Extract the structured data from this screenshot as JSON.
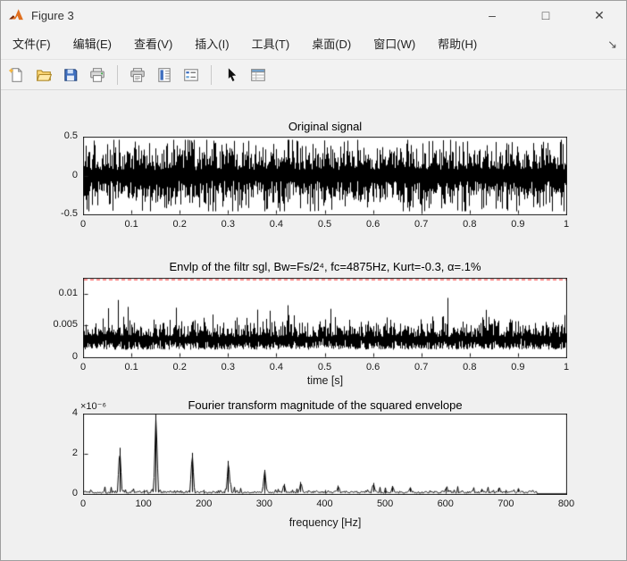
{
  "window": {
    "title": "Figure 3",
    "controls": {
      "minimize": "–",
      "maximize": "□",
      "close": "✕"
    }
  },
  "menu": {
    "items": [
      "文件(F)",
      "编辑(E)",
      "查看(V)",
      "插入(I)",
      "工具(T)",
      "桌面(D)",
      "窗口(W)",
      "帮助(H)"
    ],
    "dock_icon": "↘"
  },
  "toolbar": {
    "icons": [
      {
        "name": "new-figure"
      },
      {
        "name": "open-file"
      },
      {
        "name": "save-figure"
      },
      {
        "name": "print-figure"
      },
      {
        "name": "print-preview"
      },
      {
        "name": "insert-colorbar"
      },
      {
        "name": "insert-legend"
      },
      {
        "name": "edit-plot-pointer"
      },
      {
        "name": "property-inspector"
      }
    ]
  },
  "chart_data": [
    {
      "type": "line",
      "series_kind": "noise",
      "title": "Original signal",
      "xlabel": "",
      "xlim": [
        0,
        1
      ],
      "ylim": [
        -0.5,
        0.5
      ],
      "xticks": [
        {
          "v": 0,
          "label": "0"
        },
        {
          "v": 0.1,
          "label": "0.1"
        },
        {
          "v": 0.2,
          "label": "0.2"
        },
        {
          "v": 0.3,
          "label": "0.3"
        },
        {
          "v": 0.4,
          "label": "0.4"
        },
        {
          "v": 0.5,
          "label": "0.5"
        },
        {
          "v": 0.6,
          "label": "0.6"
        },
        {
          "v": 0.7,
          "label": "0.7"
        },
        {
          "v": 0.8,
          "label": "0.8"
        },
        {
          "v": 0.9,
          "label": "0.9"
        },
        {
          "v": 1,
          "label": "1"
        }
      ],
      "yticks": [
        {
          "v": -0.5,
          "label": "-0.5"
        },
        {
          "v": 0,
          "label": "0"
        },
        {
          "v": 0.5,
          "label": "0.5"
        }
      ],
      "line_color": "#000000",
      "description": "dense zero-mean broadband noise, typical amplitude ±0.2, spikes to ±0.45"
    },
    {
      "type": "line",
      "series_kind": "envelope",
      "title": "Envlp of the filtr sgl, Bw=Fs/2⁴, fc=4875Hz, Kurt=-0.3, α=.1%",
      "xlabel": "time [s]",
      "xlim": [
        0,
        1
      ],
      "ylim": [
        0,
        0.0125
      ],
      "xticks": [
        {
          "v": 0,
          "label": "0"
        },
        {
          "v": 0.1,
          "label": "0.1"
        },
        {
          "v": 0.2,
          "label": "0.2"
        },
        {
          "v": 0.3,
          "label": "0.3"
        },
        {
          "v": 0.4,
          "label": "0.4"
        },
        {
          "v": 0.5,
          "label": "0.5"
        },
        {
          "v": 0.6,
          "label": "0.6"
        },
        {
          "v": 0.7,
          "label": "0.7"
        },
        {
          "v": 0.8,
          "label": "0.8"
        },
        {
          "v": 0.9,
          "label": "0.9"
        },
        {
          "v": 1,
          "label": "1"
        }
      ],
      "yticks": [
        {
          "v": 0,
          "label": "0"
        },
        {
          "v": 0.005,
          "label": "0.005"
        },
        {
          "v": 0.01,
          "label": "0.01"
        }
      ],
      "line_color": "#000000",
      "threshold_line": {
        "value": 0.0122,
        "color": "#ff2222",
        "style": "dashed"
      },
      "description": "positive envelope oscillating between ~0.001 and ~0.011 with spiky peaks"
    },
    {
      "type": "line",
      "series_kind": "spectrum",
      "title": "Fourier transform magnitude of the squared envelope",
      "xlabel": "frequency [Hz]",
      "y_scale_label": "×10⁻⁶",
      "y_unit": 1e-06,
      "xlim": [
        0,
        800
      ],
      "ylim": [
        0,
        4
      ],
      "xticks": [
        {
          "v": 0,
          "label": "0"
        },
        {
          "v": 100,
          "label": "100"
        },
        {
          "v": 200,
          "label": "200"
        },
        {
          "v": 300,
          "label": "300"
        },
        {
          "v": 400,
          "label": "400"
        },
        {
          "v": 500,
          "label": "500"
        },
        {
          "v": 600,
          "label": "600"
        },
        {
          "v": 700,
          "label": "700"
        },
        {
          "v": 800,
          "label": "800"
        }
      ],
      "yticks": [
        {
          "v": 0,
          "label": "0"
        },
        {
          "v": 2,
          "label": "2"
        },
        {
          "v": 4,
          "label": "4"
        }
      ],
      "line_color": "#000000",
      "peaks_hz_amp": [
        [
          60,
          2.3
        ],
        [
          120,
          3.95
        ],
        [
          180,
          2.05
        ],
        [
          240,
          1.65
        ],
        [
          300,
          1.2
        ],
        [
          332,
          0.5
        ],
        [
          360,
          0.6
        ],
        [
          422,
          0.42
        ],
        [
          480,
          0.55
        ],
        [
          512,
          0.4
        ],
        [
          541,
          0.33
        ],
        [
          600,
          0.3
        ],
        [
          660,
          0.25
        ],
        [
          688,
          0.3
        ],
        [
          720,
          0.22
        ]
      ],
      "noise_floor": 0.2,
      "cutoff_hz": 750,
      "description": "harmonic peak train at multiples of 60 Hz over a low noise floor, spectrum ends near 750 Hz"
    }
  ]
}
